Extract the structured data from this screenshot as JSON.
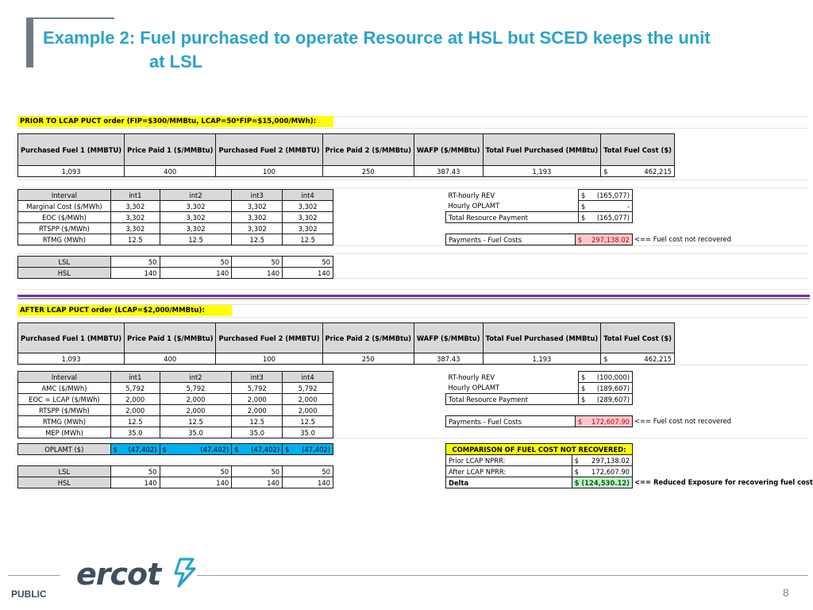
{
  "title": {
    "line1": "Example 2: Fuel purchased to operate Resource at HSL but SCED keeps the unit",
    "line2": "at LSL"
  },
  "prior": {
    "label": "PRIOR TO LCAP PUCT order (FIP=$300/MMBtu, LCAP=50*FIP=$15,000/MWh):",
    "headers": [
      "Purchased Fuel 1 (MMBTU)",
      "Price Paid 1 ($/MMBtu)",
      "Purchased Fuel 2 (MMBTU)",
      "Price Paid 2 ($/MMBtu)",
      "WAFP ($/MMBtu)",
      "Total Fuel Purchased (MMBtu)",
      "Total Fuel Cost ($)"
    ],
    "values": [
      "1,093",
      "400",
      "100",
      "250",
      "387.43",
      "1,193",
      "$",
      "462,215"
    ],
    "interval_header": [
      "Interval",
      "int1",
      "int2",
      "int3",
      "int4"
    ],
    "rows": [
      {
        "label": "Marginal Cost ($/MWh)",
        "vals": [
          "3,302",
          "3,302",
          "3,302",
          "3,302"
        ]
      },
      {
        "label": "EOC ($/MWh)",
        "vals": [
          "3,302",
          "3,302",
          "3,302",
          "3,302"
        ]
      },
      {
        "label": "RTSPP ($/MWh)",
        "vals": [
          "3,302",
          "3,302",
          "3,302",
          "3,302"
        ]
      },
      {
        "label": "RTMG (MWh)",
        "vals": [
          "12.5",
          "12.5",
          "12.5",
          "12.5"
        ]
      }
    ],
    "lsl": {
      "label": "LSL",
      "vals": [
        "50",
        "50",
        "50",
        "50"
      ]
    },
    "hsl": {
      "label": "HSL",
      "vals": [
        "140",
        "140",
        "140",
        "140"
      ]
    },
    "summary": [
      {
        "label": "RT-hourly REV",
        "cur": "$",
        "val": "(165,077)"
      },
      {
        "label": "Hourly OPLAMT",
        "cur": "$",
        "val": "-"
      },
      {
        "label": "Total Resource Payment",
        "cur": "$",
        "val": "(165,077)"
      }
    ],
    "fuel_costs": {
      "label": "Payments - Fuel Costs",
      "cur": "$",
      "val": "297,138.02",
      "note": "<== Fuel cost not recovered"
    }
  },
  "after": {
    "label": "AFTER LCAP PUCT order (LCAP=$2,000/MMBtu):",
    "headers": [
      "Purchased Fuel 1 (MMBTU)",
      "Price Paid 1 ($/MMBtu)",
      "Purchased Fuel 2 (MMBTU)",
      "Price Paid 2 ($/MMBtu)",
      "WAFP ($/MMBtu)",
      "Total Fuel Purchased (MMBtu)",
      "Total Fuel Cost ($)"
    ],
    "values": [
      "1,093",
      "400",
      "100",
      "250",
      "387.43",
      "1,193",
      "$",
      "462,215"
    ],
    "interval_header": [
      "Interval",
      "int1",
      "int2",
      "int3",
      "int4"
    ],
    "rows": [
      {
        "label": "AMC ($/MWh)",
        "vals": [
          "5,792",
          "5,792",
          "5,792",
          "5,792"
        ]
      },
      {
        "label": "EOC = LCAP ($/MWh)",
        "vals": [
          "2,000",
          "2,000",
          "2,000",
          "2,000"
        ]
      },
      {
        "label": "RTSPP ($/MWh)",
        "vals": [
          "2,000",
          "2,000",
          "2,000",
          "2,000"
        ]
      },
      {
        "label": "RTMG (MWh)",
        "vals": [
          "12.5",
          "12.5",
          "12.5",
          "12.5"
        ]
      },
      {
        "label": "MEP (MWh)",
        "vals": [
          "35.0",
          "35.0",
          "35.0",
          "35.0"
        ]
      }
    ],
    "oplamt": {
      "label": "OPLAMT ($)",
      "cur": "$",
      "vals": [
        "(47,402)",
        "(47,402)",
        "(47,402)",
        "(47,402)"
      ]
    },
    "lsl": {
      "label": "LSL",
      "vals": [
        "50",
        "50",
        "50",
        "50"
      ]
    },
    "hsl": {
      "label": "HSL",
      "vals": [
        "140",
        "140",
        "140",
        "140"
      ]
    },
    "summary": [
      {
        "label": "RT-hourly REV",
        "cur": "$",
        "val": "(100,000)"
      },
      {
        "label": "Hourly OPLAMT",
        "cur": "$",
        "val": "(189,607)"
      },
      {
        "label": "Total Resource Payment",
        "cur": "$",
        "val": "(289,607)"
      }
    ],
    "fuel_costs": {
      "label": "Payments - Fuel Costs",
      "cur": "$",
      "val": "172,607.90",
      "note": "<== Fuel cost not recovered"
    },
    "comparison": {
      "title": "COMPARISON OF FUEL COST NOT RECOVERED:",
      "rows": [
        {
          "label": "Prior LCAP NPRR:",
          "cur": "$",
          "val": "297,138.02"
        },
        {
          "label": "After LCAP NPRR:",
          "cur": "$",
          "val": "172,607.90"
        }
      ],
      "delta": {
        "label": "Delta",
        "val": "$ (124,530.12)",
        "note": "<== Reduced Exposure for recovering fuel cost"
      }
    }
  },
  "footer": {
    "logo": "ercot",
    "public": "PUBLIC",
    "page": "8"
  }
}
